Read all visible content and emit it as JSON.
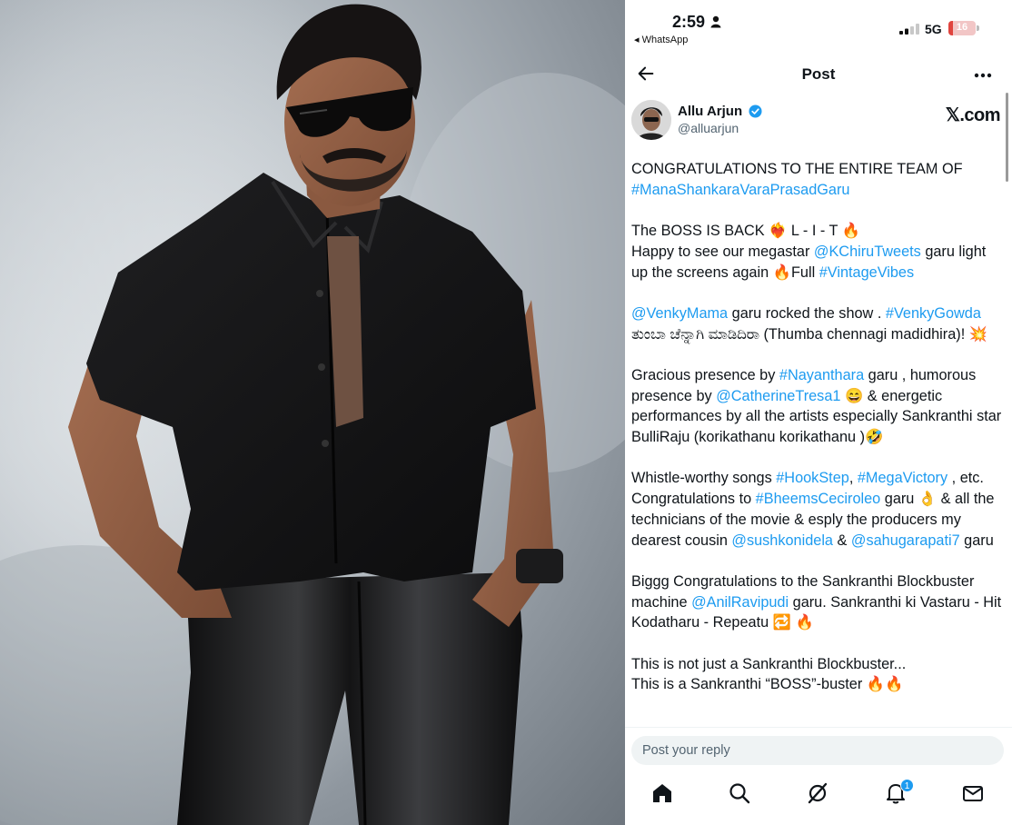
{
  "photo": {
    "subject": "man in black shirt and sunglasses"
  },
  "status_bar": {
    "time": "2:59",
    "back_app": "◂ WhatsApp",
    "network": "5G",
    "battery_level": "16",
    "battery_fraction": 0.16
  },
  "header": {
    "title": "Post"
  },
  "author": {
    "name": "Allu Arjun",
    "handle": "@alluarjun",
    "source": "𝕏.com"
  },
  "post": {
    "p1": {
      "t1": "CONGRATULATIONS TO THE ENTIRE TEAM OF ",
      "l1": "#ManaShankaraVaraPrasadGaru"
    },
    "p2": {
      "t1": "The BOSS IS BACK ❤️‍🔥 L - I - T 🔥",
      "t2": "Happy to see our megastar ",
      "l1": "@KChiruTweets",
      "t3": " garu light up the screens again 🔥Full ",
      "l2": "#VintageVibes"
    },
    "p3": {
      "l1": "@VenkyMama",
      "t1": " garu rocked the show . ",
      "l2": "#VenkyGowda",
      "t2": " ತುಂಬಾ ಚೆನ್ನಾಗಿ ಮಾಡಿದಿರಾ (Thumba chennagi madidhira)! 💥"
    },
    "p4": {
      "t1": "Gracious presence by ",
      "l1": "#Nayanthara",
      "t2": " garu , humorous presence by ",
      "l2": "@CatherineTresa1",
      "t3": " 😄 & energetic performances by all the artists especially Sankranthi star BulliRaju (korikathanu korikathanu )🤣"
    },
    "p5": {
      "t1": "Whistle-worthy songs  ",
      "l1": "#HookStep",
      "t2": ", ",
      "l2": "#MegaVictory",
      "t3": " , etc. Congratulations to ",
      "l3": "#BheemsCeciroleo",
      "t4": " garu 👌 & all the technicians of the movie & esply the producers my dearest cousin ",
      "l4": "@sushkonidela",
      "t5": " & ",
      "l5": "@sahugarapati7",
      "t6": " garu"
    },
    "p6": {
      "t1": "Biggg Congratulations to the Sankranthi Blockbuster machine ",
      "l1": "@AnilRavipudi",
      "t2": " garu. Sankranthi ki Vastaru - Hit Kodatharu - Repeatu 🔁 🔥"
    },
    "p7": {
      "t1": "This is not just a Sankranthi Blockbuster...",
      "t2": "This is a Sankranthi “BOSS”-buster 🔥🔥"
    }
  },
  "reply": {
    "placeholder": "Post your reply"
  },
  "tabbar": {
    "icons": [
      "home-icon",
      "search-icon",
      "grok-icon",
      "notifications-icon",
      "messages-icon"
    ],
    "notification_count": "1"
  },
  "colors": {
    "link": "#1d9bf0",
    "verified": "#1d9bf0",
    "battery_low": "#e0443e"
  }
}
